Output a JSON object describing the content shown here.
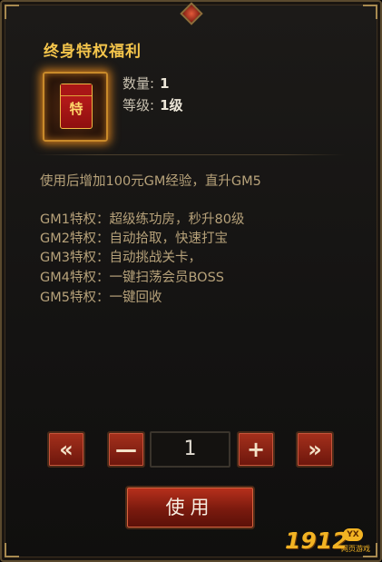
{
  "panel": {
    "title": "终身特权福利"
  },
  "item": {
    "icon": "red-envelope-icon",
    "envelope_char": "特",
    "quantity_label": "数量:",
    "quantity_value": "1",
    "level_label": "等级:",
    "level_value": "1级"
  },
  "description": "使用后增加100元GM经验，直升GM5",
  "perks": [
    "GM1特权：超级练功房，秒升80级",
    "GM2特权：自动拾取，快速打宝",
    "GM3特权：自动挑战关卡，",
    "GM4特权：一键扫荡会员BOSS",
    "GM5特权：一键回收"
  ],
  "controls": {
    "first_icon": "double-chevron-left-icon",
    "first_glyph": "«",
    "minus_glyph": "—",
    "quantity": "1",
    "plus_glyph": "+",
    "last_icon": "double-chevron-right-icon",
    "last_glyph": "»"
  },
  "use_button": "使用",
  "watermark": {
    "number": "1912",
    "badge": "YX",
    "sub": "网页游戏"
  },
  "colors": {
    "title": "#f3c44b",
    "perk_text": "#b7a27a",
    "button_red": "#a5301c"
  }
}
